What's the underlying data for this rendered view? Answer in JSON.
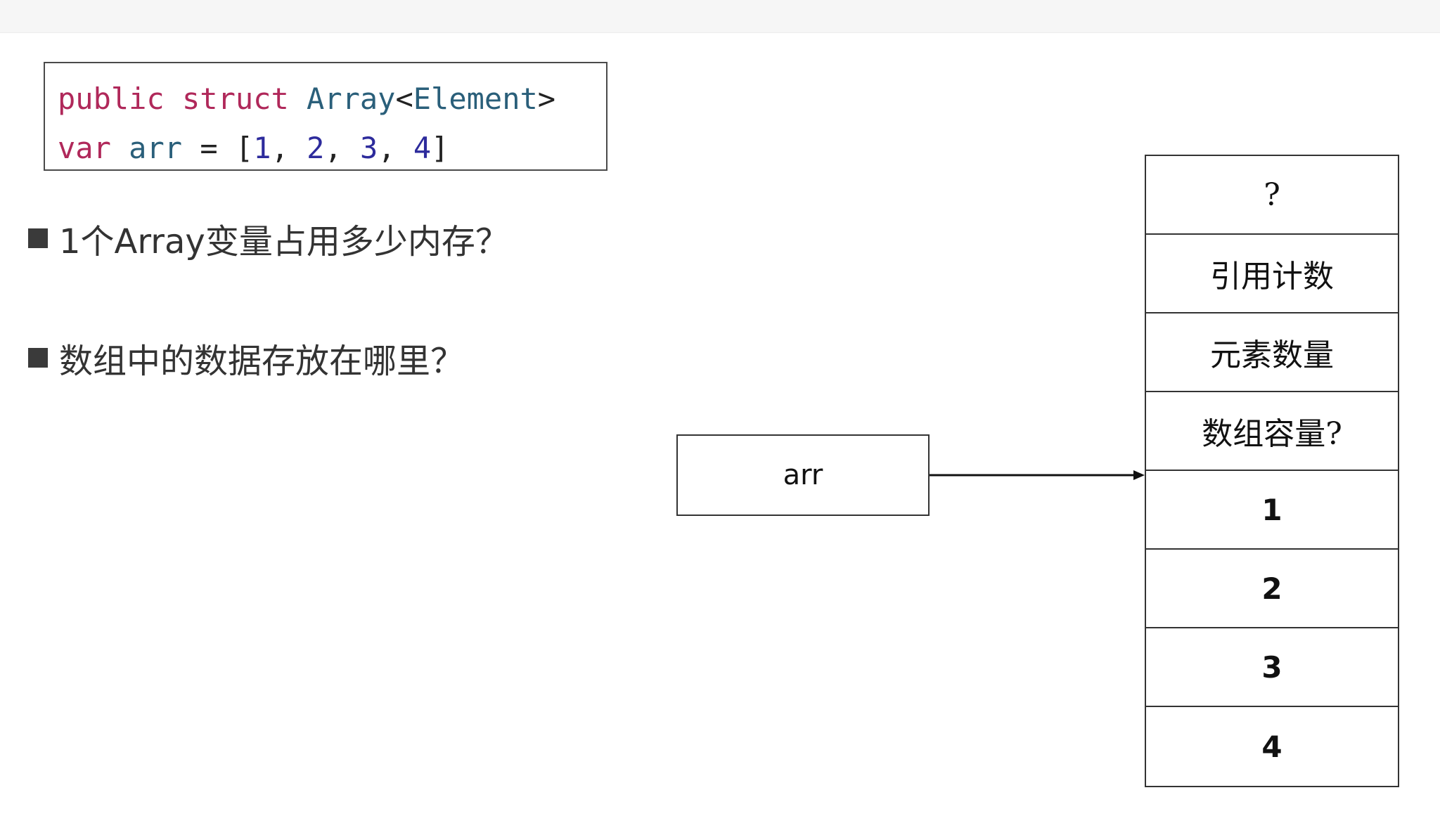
{
  "code": {
    "line1": {
      "kw1": "public",
      "kw2": "struct",
      "type": "Array",
      "lt": "<",
      "generic": "Element",
      "gt": ">"
    },
    "line2": {
      "kw": "var",
      "ident": "arr",
      "eq": "=",
      "open": "[",
      "n1": "1",
      "c1": ",",
      "n2": "2",
      "c2": ",",
      "n3": "3",
      "c3": ",",
      "n4": "4",
      "close": "]"
    }
  },
  "bullets": [
    {
      "text": "1个Array变量占用多少内存？"
    },
    {
      "text": "数组中的数据存放在哪里？"
    }
  ],
  "variable": {
    "label": "arr"
  },
  "heap": {
    "cells": [
      {
        "text": "?"
      },
      {
        "text": "引用计数"
      },
      {
        "text": "元素数量"
      },
      {
        "text": "数组容量?"
      },
      {
        "text": "1"
      },
      {
        "text": "2"
      },
      {
        "text": "3"
      },
      {
        "text": "4"
      }
    ]
  },
  "colors": {
    "keyword": "#b0285a",
    "type": "#2a5f7a",
    "number": "#2d2b9c",
    "border": "#333333"
  }
}
